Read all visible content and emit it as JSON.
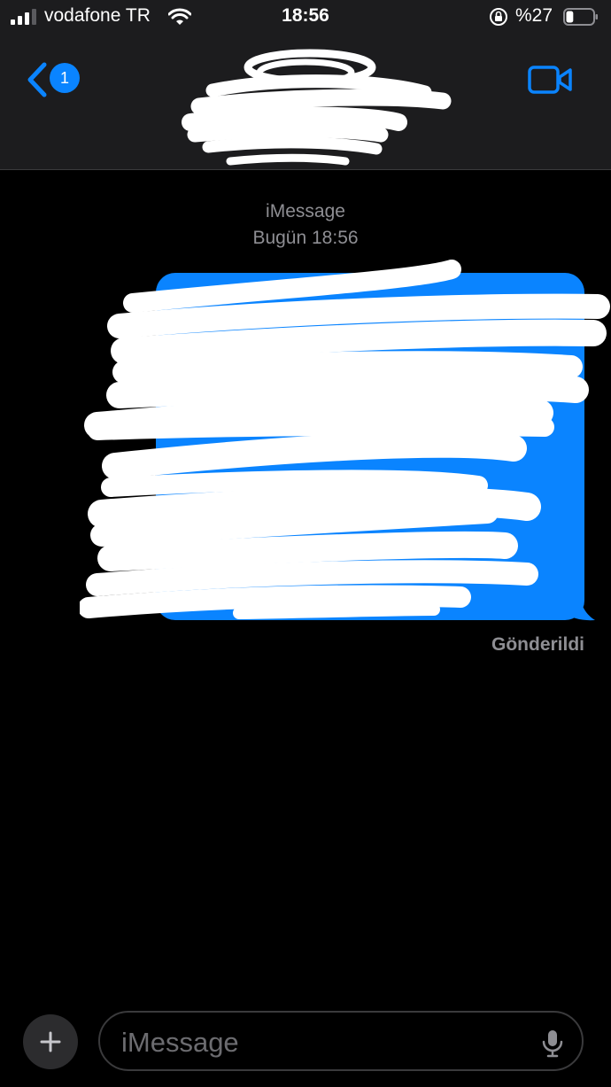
{
  "status_bar": {
    "carrier": "vodafone TR",
    "time": "18:56",
    "battery_percent": "%27",
    "battery_level": 0.27,
    "signal_bars": 3
  },
  "nav": {
    "back_icon": "chevron-left-icon",
    "unread_badge": "1",
    "contact_name_redacted": true,
    "video_icon": "video-camera-icon"
  },
  "conversation": {
    "service": "iMessage",
    "timestamp": "Bugün 18:56",
    "message_redacted": true,
    "status": "Gönderildi"
  },
  "composer": {
    "add_icon": "plus-icon",
    "placeholder": "iMessage",
    "mic_icon": "microphone-icon"
  },
  "colors": {
    "accent": "#0a84ff",
    "bar_background": "#1c1c1e",
    "secondary_text": "#8e8e93"
  }
}
